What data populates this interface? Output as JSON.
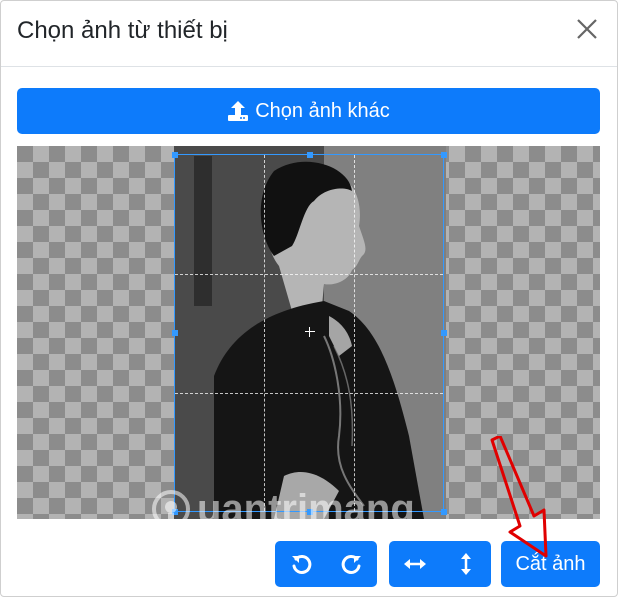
{
  "dialog": {
    "title": "Chọn ảnh từ thiết bị",
    "close_icon": "close-icon"
  },
  "upload": {
    "label": "Chọn ảnh khác",
    "icon": "upload-icon"
  },
  "toolbar": {
    "rotate_left_icon": "rotate-left-icon",
    "rotate_right_icon": "rotate-right-icon",
    "flip_horizontal_icon": "flip-horizontal-icon",
    "flip_vertical_icon": "flip-vertical-icon",
    "crop_label": "Cắt ảnh"
  },
  "watermark": {
    "text": "uantrimang"
  },
  "colors": {
    "primary": "#0d7bfb",
    "crop_border": "#3399ff",
    "annotation_arrow": "#e00000"
  }
}
